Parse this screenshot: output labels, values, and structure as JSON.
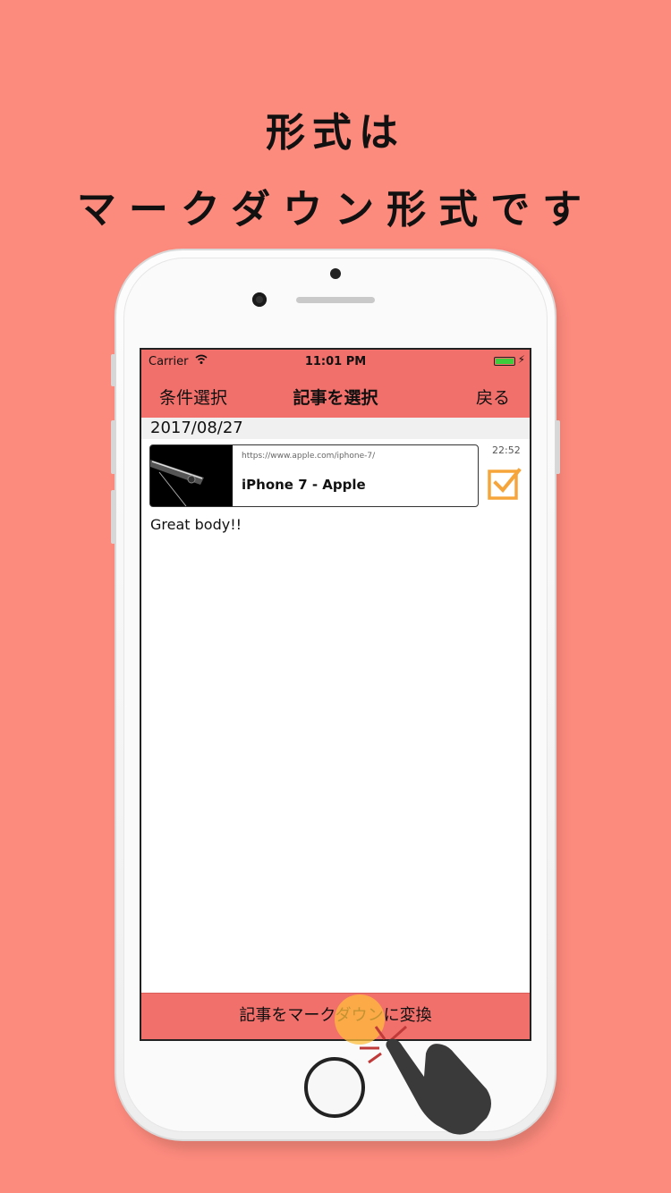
{
  "headline": {
    "line1": "形式は",
    "line2": "マークダウン形式です"
  },
  "statusbar": {
    "carrier": "Carrier",
    "time": "11:01 PM"
  },
  "navbar": {
    "left": "条件選択",
    "title": "記事を選択",
    "right": "戻る"
  },
  "section": {
    "date": "2017/08/27"
  },
  "article": {
    "url": "https://www.apple.com/iphone-7/",
    "title": "iPhone 7 - Apple",
    "time": "22:52",
    "comment": "Great body!!",
    "checked": true
  },
  "bottom_button": {
    "label": "記事をマークダウンに変換"
  },
  "colors": {
    "background": "#fc8a7d",
    "bar": "#f2706b",
    "check": "#f5a53a"
  },
  "icons": [
    "wifi-icon",
    "battery-icon",
    "bolt-icon",
    "checkbox-icon",
    "hand-tap-icon"
  ]
}
